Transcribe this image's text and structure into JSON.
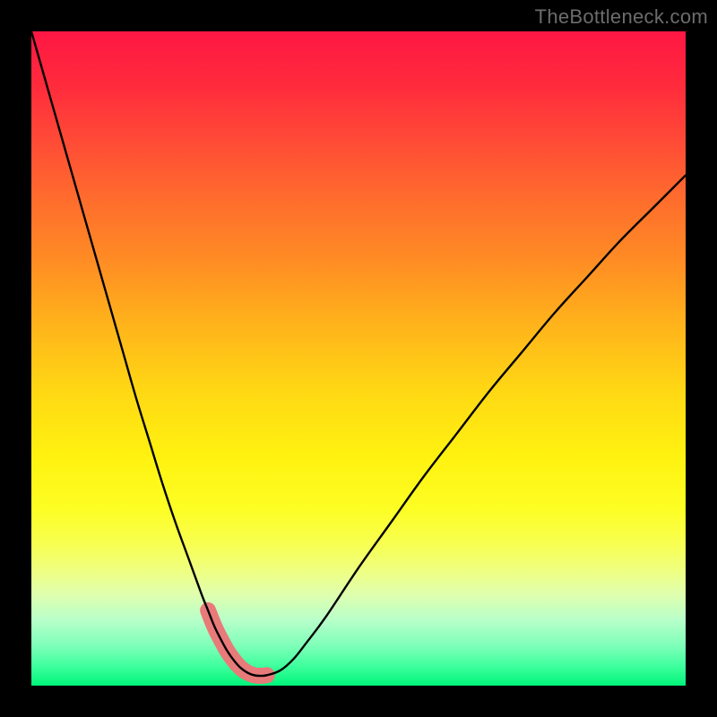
{
  "watermark": "TheBottleneck.com",
  "chart_data": {
    "type": "line",
    "title": "",
    "xlabel": "",
    "ylabel": "",
    "xlim": [
      0,
      100
    ],
    "ylim": [
      0,
      100
    ],
    "series": [
      {
        "name": "bottleneck-curve",
        "x": [
          0,
          2,
          4,
          6,
          8,
          10,
          12,
          14,
          16,
          18,
          20,
          22,
          24,
          26,
          27,
          28,
          29,
          30,
          31,
          32,
          33,
          34,
          35,
          36,
          38,
          40,
          42,
          45,
          50,
          55,
          60,
          65,
          70,
          75,
          80,
          85,
          90,
          95,
          100
        ],
        "y": [
          100,
          93,
          86,
          79,
          72,
          65,
          58,
          51,
          44,
          37.5,
          31,
          25,
          19.5,
          14,
          11.5,
          9,
          7,
          5.2,
          3.8,
          2.7,
          2.0,
          1.6,
          1.5,
          1.6,
          2.3,
          4.0,
          6.5,
          10.5,
          18,
          25,
          32,
          38.5,
          45,
          51,
          57,
          62.5,
          68,
          73,
          78
        ]
      }
    ],
    "tolerance_band": {
      "name": "highlight-band",
      "x": [
        27,
        28,
        29,
        30,
        31,
        32,
        33,
        34,
        35,
        36
      ],
      "y": [
        11.5,
        9,
        7,
        5.2,
        3.8,
        2.7,
        2.0,
        1.6,
        1.5,
        1.6
      ]
    }
  }
}
